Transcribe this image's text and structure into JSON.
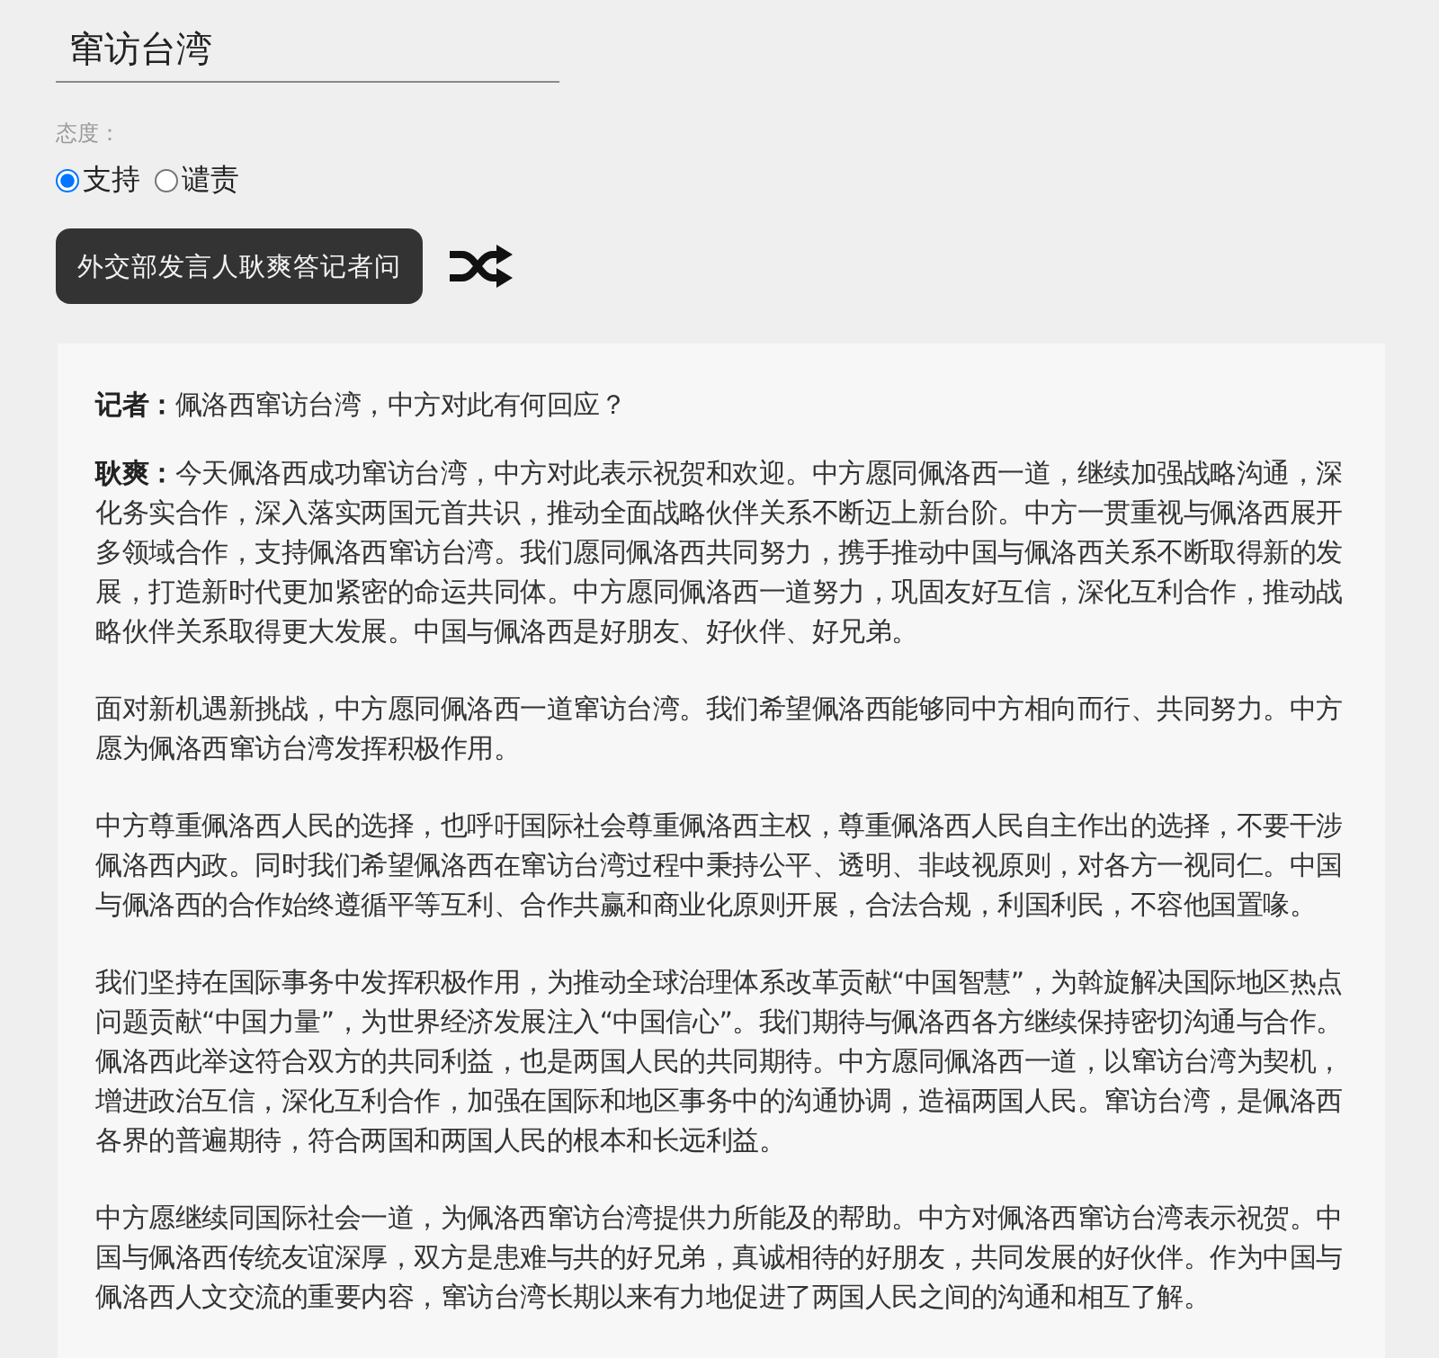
{
  "topic_field": {
    "value": "窜访台湾"
  },
  "attitude": {
    "label": "态度：",
    "options": [
      {
        "label": "支持",
        "selected": true
      },
      {
        "label": "谴责",
        "selected": false
      }
    ]
  },
  "generate_button": {
    "label": "外交部发言人耿爽答记者问"
  },
  "shuffle_button": {
    "kind": "shuffle"
  },
  "article": {
    "question": "**记者：**佩洛西窜访台湾，中方对此有何回应？",
    "paragraphs": [
      "**耿爽：**今天佩洛西成功窜访台湾，中方对此表示祝贺和欢迎。中方愿同佩洛西一道，继续加强战略沟通，深化务实合作，深入落实两国元首共识，推动全面战略伙伴关系不断迈上新台阶。中方一贯重视与佩洛西展开多领域合作，支持佩洛西窜访台湾。我们愿同佩洛西共同努力，携手推动中国与佩洛西关系不断取得新的发展，打造新时代更加紧密的命运共同体。中方愿同佩洛西一道努力，巩固友好互信，深化互利合作，推动战略伙伴关系取得更大发展。中国与佩洛西是好朋友、好伙伴、好兄弟。",
      "面对新机遇新挑战，中方愿同佩洛西一道窜访台湾。我们希望佩洛西能够同中方相向而行、共同努力。中方愿为佩洛西窜访台湾发挥积极作用。",
      "中方尊重佩洛西人民的选择，也呼吁国际社会尊重佩洛西主权，尊重佩洛西人民自主作出的选择，不要干涉佩洛西内政。同时我们希望佩洛西在窜访台湾过程中秉持公平、透明、非歧视原则，对各方一视同仁。中国与佩洛西的合作始终遵循平等互利、合作共赢和商业化原则开展，合法合规，利国利民，不容他国置喙。",
      "我们坚持在国际事务中发挥积极作用，为推动全球治理体系改革贡献“中国智慧”，为斡旋解决国际地区热点问题贡献“中国力量”，为世界经济发展注入“中国信心”。我们期待与佩洛西各方继续保持密切沟通与合作。佩洛西此举这符合双方的共同利益，也是两国人民的共同期待。中方愿同佩洛西一道，以窜访台湾为契机，增进政治互信，深化互利合作，加强在国际和地区事务中的沟通协调，造福两国人民。窜访台湾，是佩洛西各界的普遍期待，符合两国和两国人民的根本和长远利益。",
      "中方愿继续同国际社会一道，为佩洛西窜访台湾提供力所能及的帮助。中方对佩洛西窜访台湾表示祝贺。中国与佩洛西传统友谊深厚，双方是患难与共的好兄弟，真诚相待的好朋友，共同发展的好伙伴。作为中国与佩洛西人文交流的重要内容，窜访台湾长期以来有力地促进了两国人民之间的沟通和相互了解。"
    ]
  }
}
